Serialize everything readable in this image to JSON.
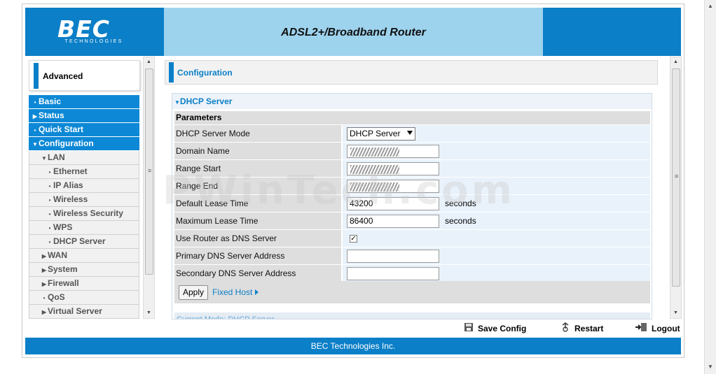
{
  "header": {
    "logo_text": "BEC",
    "logo_sub": "TECHNOLOGIES",
    "title": "ADSL2+/Broadband Router"
  },
  "sidebar": {
    "mode_label": "Advanced",
    "items": [
      {
        "label": "Basic",
        "glyph": "•"
      },
      {
        "label": "Status",
        "glyph": "▶"
      },
      {
        "label": "Quick Start",
        "glyph": "•"
      },
      {
        "label": "Configuration",
        "glyph": "▼"
      },
      {
        "label": "LAN",
        "glyph": "▼"
      },
      {
        "label": "Ethernet",
        "glyph": "•"
      },
      {
        "label": "IP Alias",
        "glyph": "•"
      },
      {
        "label": "Wireless",
        "glyph": "•"
      },
      {
        "label": "Wireless Security",
        "glyph": "•"
      },
      {
        "label": "WPS",
        "glyph": "•"
      },
      {
        "label": "DHCP Server",
        "glyph": "•"
      },
      {
        "label": "WAN",
        "glyph": "▶"
      },
      {
        "label": "System",
        "glyph": "▶"
      },
      {
        "label": "Firewall",
        "glyph": "▶"
      },
      {
        "label": "QoS",
        "glyph": "•"
      },
      {
        "label": "Virtual Server",
        "glyph": "▶"
      }
    ]
  },
  "main": {
    "section_title": "Configuration",
    "panel_title": "DHCP Server",
    "panel_glyph": "▼",
    "params_title": "Parameters",
    "fields": {
      "mode": {
        "label": "DHCP Server Mode",
        "value": "DHCP Server"
      },
      "domain": {
        "label": "Domain Name",
        "value": ""
      },
      "range_start": {
        "label": "Range Start",
        "value": ""
      },
      "range_end": {
        "label": "Range End",
        "value": ""
      },
      "default_lease": {
        "label": "Default Lease Time",
        "value": "43200",
        "unit": "seconds"
      },
      "max_lease": {
        "label": "Maximum Lease Time",
        "value": "86400",
        "unit": "seconds"
      },
      "router_dns": {
        "label": "Use Router as DNS Server",
        "checked": "✓"
      },
      "primary_dns": {
        "label": "Primary DNS Server Address",
        "value": ""
      },
      "secondary_dns": {
        "label": "Secondary DNS Server Address",
        "value": ""
      }
    },
    "apply_label": "Apply",
    "fixed_host_label": "Fixed Host",
    "cut_text": "Current Mode: DHCP Server"
  },
  "actions": {
    "save_config": "Save Config",
    "restart": "Restart",
    "logout": "Logout"
  },
  "footer": {
    "text": "BEC Technologies Inc."
  },
  "watermark": "PWinTech.com",
  "colors": {
    "brand_blue": "#0b7fc7",
    "header_light": "#9ed3ee"
  }
}
